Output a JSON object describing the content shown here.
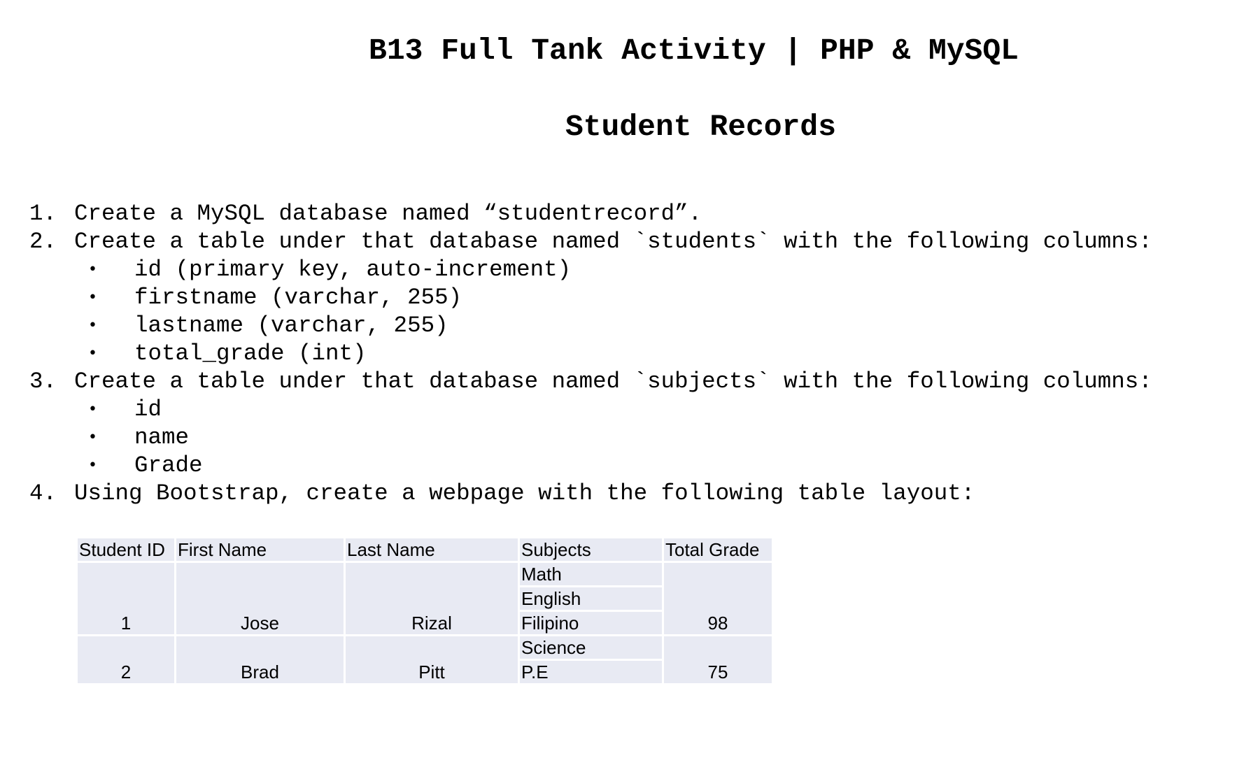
{
  "document": {
    "title": "B13 Full Tank Activity | PHP & MySQL",
    "subtitle": "Student Records",
    "steps": [
      {
        "number": "1.",
        "text": "Create a MySQL database named “studentrecord”."
      },
      {
        "number": "2.",
        "text": "Create a table under that database named `students` with the following columns:"
      },
      {
        "number": "3.",
        "text": "Create a table under that database named `subjects` with the following columns:"
      },
      {
        "number": "4.",
        "text": "Using Bootstrap, create a webpage with the following table layout:"
      }
    ],
    "students_columns": [
      "id (primary key, auto-increment)",
      "firstname (varchar, 255)",
      "lastname (varchar, 255)",
      "total_grade (int)"
    ],
    "subjects_columns": [
      "id",
      "name",
      "Grade"
    ],
    "bullet_symbol": "•"
  },
  "table": {
    "headers": [
      "Student ID",
      "First Name",
      "Last Name",
      "Subjects",
      "Total Grade"
    ],
    "rows": [
      {
        "student_id": "1",
        "first_name": "Jose",
        "last_name": "Rizal",
        "subjects": [
          "Math",
          "English",
          "Filipino"
        ],
        "total_grade": "98"
      },
      {
        "student_id": "2",
        "first_name": "Brad",
        "last_name": "Pitt",
        "subjects": [
          "Science",
          "P.E"
        ],
        "total_grade": "75"
      }
    ]
  },
  "colors": {
    "table_cell_background": "#e8eaf3",
    "table_border": "#ffffff",
    "text": "#000000"
  }
}
